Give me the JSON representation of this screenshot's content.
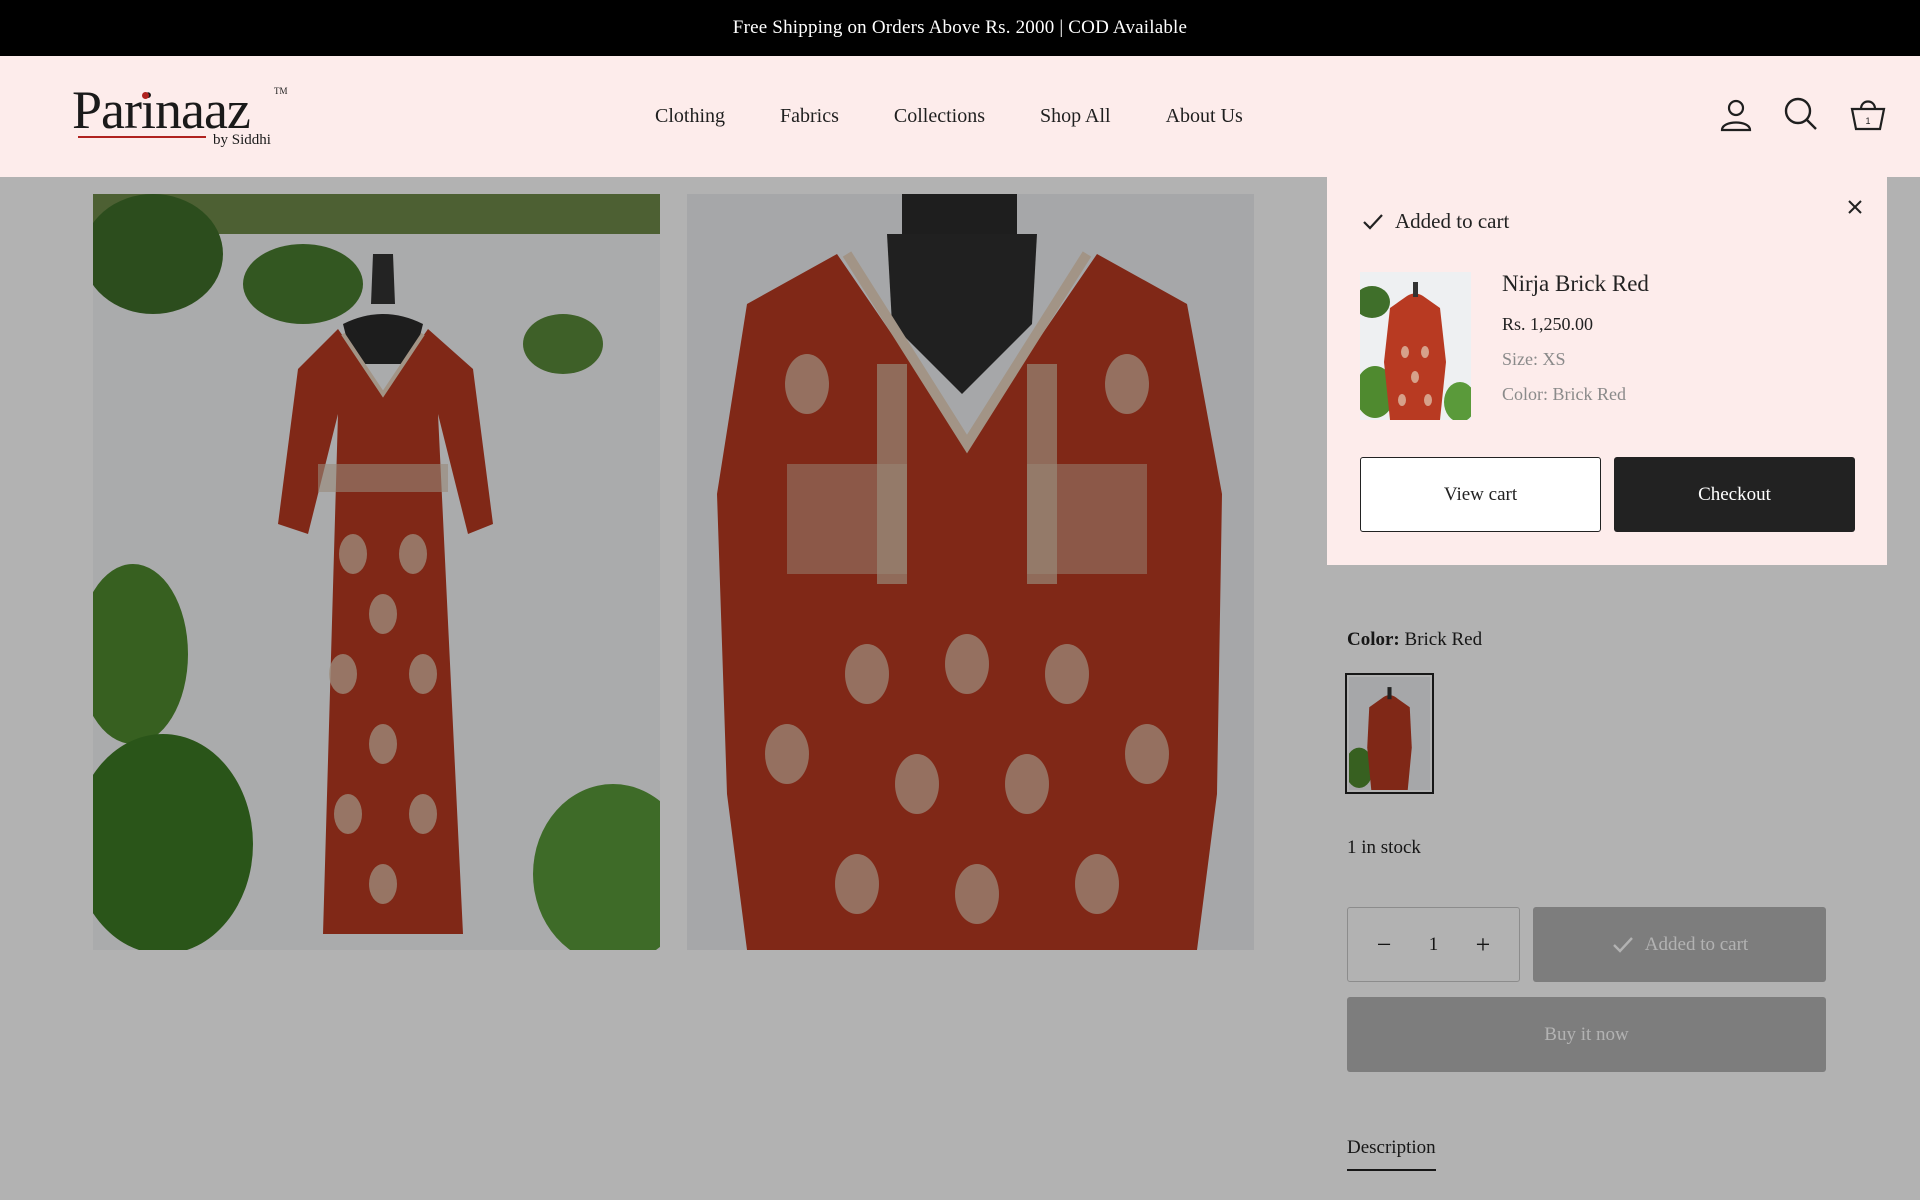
{
  "announcement": "Free Shipping on Orders Above Rs. 2000 | COD Available",
  "brand": {
    "name": "Parinaaz",
    "trademark": "TM",
    "tagline": "by Siddhi"
  },
  "nav": [
    "Clothing",
    "Fabrics",
    "Collections",
    "Shop All",
    "About Us"
  ],
  "header_icons": [
    "account-icon",
    "search-icon",
    "cart-icon"
  ],
  "cart_count": "1",
  "product": {
    "color_label": "Color:",
    "color_value": "Brick Red",
    "stock": "1 in stock",
    "quantity": "1",
    "added_button": "Added to cart",
    "buy_now": "Buy it now",
    "description_tab": "Description",
    "partial_text": "XS"
  },
  "cart_popup": {
    "heading": "Added to cart",
    "item_name": "Nirja Brick Red",
    "price": "Rs. 1,250.00",
    "size": "Size: XS",
    "color": "Color: Brick Red",
    "view_cart": "View cart",
    "checkout": "Checkout"
  },
  "colors": {
    "announcement_bg": "#000000",
    "header_bg": "#fdeceb",
    "popup_bg": "#fdeceb",
    "brand_red": "#b0221f",
    "dress_red": "#b83a22",
    "dark_button": "#222222"
  }
}
